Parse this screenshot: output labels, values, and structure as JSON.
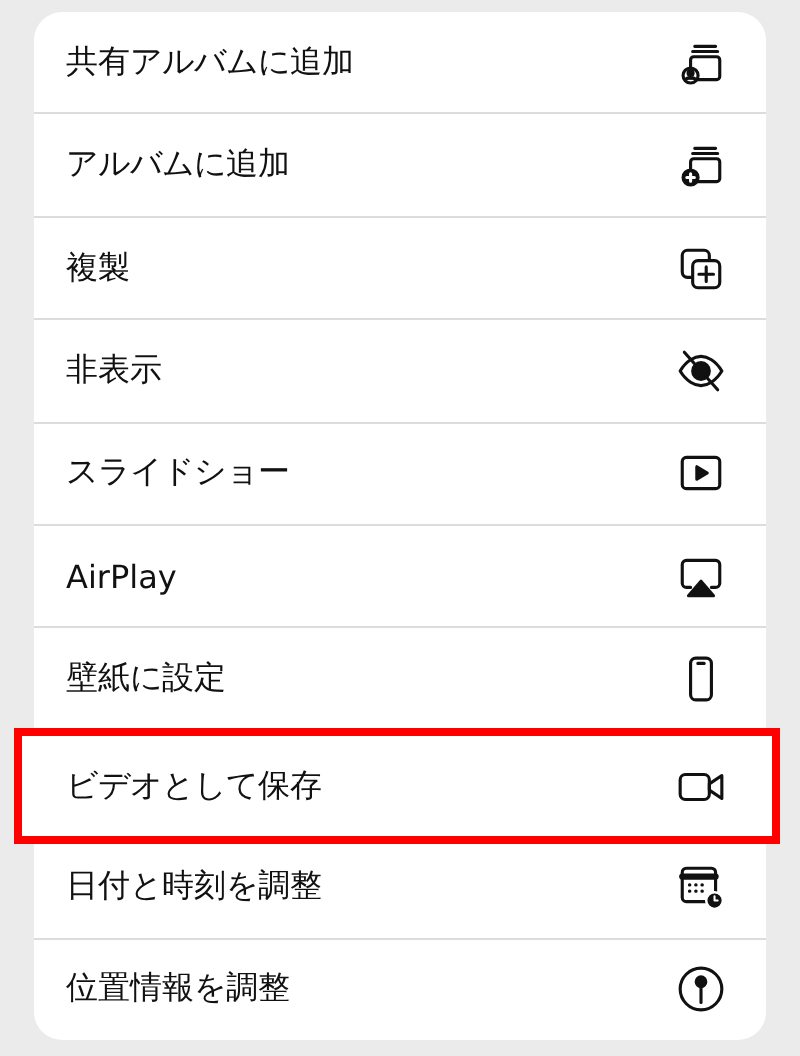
{
  "menu": {
    "items": [
      {
        "label": "共有アルバムに追加",
        "highlighted": false
      },
      {
        "label": "アルバムに追加",
        "highlighted": false
      },
      {
        "label": "複製",
        "highlighted": false
      },
      {
        "label": "非表示",
        "highlighted": false
      },
      {
        "label": "スライドショー",
        "highlighted": false
      },
      {
        "label": "AirPlay",
        "highlighted": false
      },
      {
        "label": "壁紙に設定",
        "highlighted": false
      },
      {
        "label": "ビデオとして保存",
        "highlighted": true
      },
      {
        "label": "日付と時刻を調整",
        "highlighted": false
      },
      {
        "label": "位置情報を調整",
        "highlighted": false
      }
    ]
  }
}
